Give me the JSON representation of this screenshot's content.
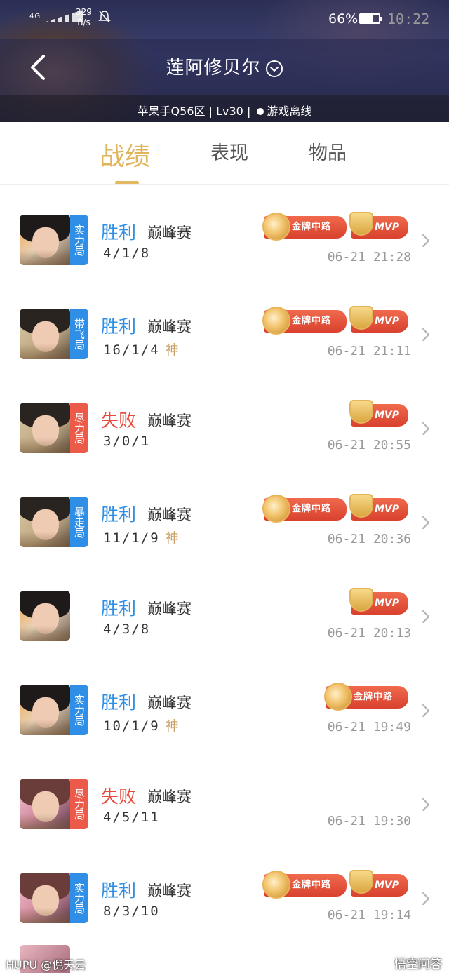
{
  "status_bar": {
    "network": "4G",
    "speed_value": "329",
    "speed_unit": "B/s",
    "battery": "66%",
    "time": "10:22"
  },
  "header": {
    "player_name": "莲阿修贝尔",
    "server": "苹果手Q56区",
    "level": "Lv30",
    "status": "游戏离线",
    "separator": "|"
  },
  "tabs": [
    {
      "label": "战绩",
      "active": true
    },
    {
      "label": "表现",
      "active": false
    },
    {
      "label": "物品",
      "active": false
    }
  ],
  "matches": [
    {
      "avatar": "hero-a",
      "tag": "实力局",
      "tag_color": "#2f8fe6",
      "result": "胜利",
      "win": true,
      "mode": "巅峰赛",
      "kda": "4/1/8",
      "god": "",
      "gold_badge": "金牌中路",
      "mvp": "MVP",
      "time": "06-21 21:28"
    },
    {
      "avatar": "hero-b",
      "tag": "带飞局",
      "tag_color": "#2f8fe6",
      "result": "胜利",
      "win": true,
      "mode": "巅峰赛",
      "kda": "16/1/4",
      "god": "神",
      "gold_badge": "金牌中路",
      "mvp": "MVP",
      "time": "06-21 21:11"
    },
    {
      "avatar": "hero-b",
      "tag": "尽力局",
      "tag_color": "#ec5a4a",
      "result": "失败",
      "win": false,
      "mode": "巅峰赛",
      "kda": "3/0/1",
      "god": "",
      "gold_badge": "",
      "mvp": "MVP",
      "time": "06-21 20:55"
    },
    {
      "avatar": "hero-b",
      "tag": "暴走局",
      "tag_color": "#2f8fe6",
      "result": "胜利",
      "win": true,
      "mode": "巅峰赛",
      "kda": "11/1/9",
      "god": "神",
      "gold_badge": "金牌中路",
      "mvp": "MVP",
      "time": "06-21 20:36"
    },
    {
      "avatar": "hero-a",
      "tag": "",
      "tag_color": "",
      "result": "胜利",
      "win": true,
      "mode": "巅峰赛",
      "kda": "4/3/8",
      "god": "",
      "gold_badge": "",
      "mvp": "MVP",
      "time": "06-21 20:13"
    },
    {
      "avatar": "hero-a",
      "tag": "实力局",
      "tag_color": "#2f8fe6",
      "result": "胜利",
      "win": true,
      "mode": "巅峰赛",
      "kda": "10/1/9",
      "god": "神",
      "gold_badge": "金牌中路",
      "mvp": "",
      "time": "06-21 19:49"
    },
    {
      "avatar": "hero-c",
      "tag": "尽力局",
      "tag_color": "#ec5a4a",
      "result": "失败",
      "win": false,
      "mode": "巅峰赛",
      "kda": "4/5/11",
      "god": "",
      "gold_badge": "",
      "mvp": "",
      "time": "06-21 19:30"
    },
    {
      "avatar": "hero-c",
      "tag": "实力局",
      "tag_color": "#2f8fe6",
      "result": "胜利",
      "win": true,
      "mode": "巅峰赛",
      "kda": "8/3/10",
      "god": "",
      "gold_badge": "金牌中路",
      "mvp": "MVP",
      "time": "06-21 19:14"
    }
  ],
  "watermark": {
    "left": "HUPU @倪天云",
    "right": "悟空问答"
  },
  "colors": {
    "accent_gold": "#e0b45a",
    "win_blue": "#2f8fe6",
    "loss_red": "#e84b3b",
    "badge_red": "#e0523a"
  }
}
